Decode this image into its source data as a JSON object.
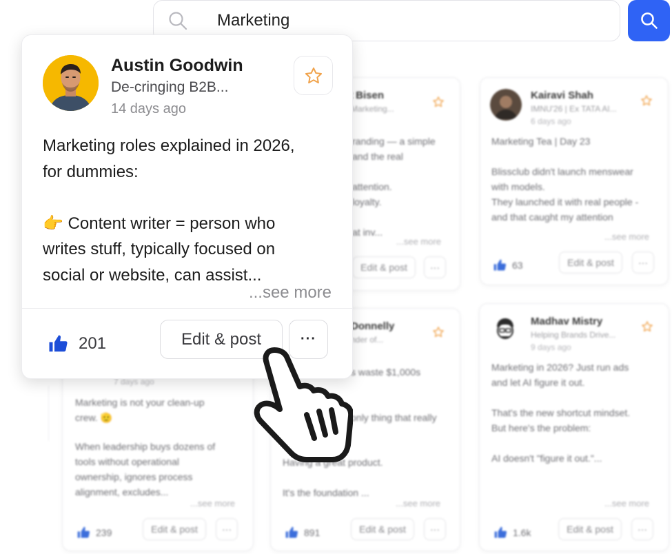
{
  "search": {
    "query": "Marketing",
    "icon": "search-icon",
    "button_icon": "search-icon",
    "button_color": "#2f63f5"
  },
  "featured_post": {
    "author": "Austin Goodwin",
    "headline": "De-cringing B2B...",
    "age": "14 days ago",
    "text_lines": [
      "Marketing roles explained in 2026,",
      "for dummies:",
      "",
      "👉 Content writer = person who",
      "writes stuff, typically focused on",
      "social or website, can assist..."
    ],
    "see_more": "...see more",
    "likes": "201",
    "edit_label": "Edit & post",
    "more_label": "···",
    "star_icon": "star-icon",
    "like_icon": "thumbs-up-icon"
  },
  "background_posts": [
    {
      "name": "t Bisen",
      "sub": "Marketing...",
      "body": [
        "randing — a simple",
        "and the real",
        "",
        "attention.",
        "loyalty.",
        "",
        "at inv..."
      ],
      "see_more": "...see more",
      "likes": "",
      "edit_label": "Edit & post",
      "more_label": "···"
    },
    {
      "name": "Kairavi Shah",
      "sub": "IMNU'26 | Ex TATA AI...",
      "age": "6 days ago",
      "body": [
        "Marketing Tea | Day 23",
        "",
        "Blissclub didn't launch menswear",
        "with models.",
        "They launched it with real people -",
        "and that caught my attention"
      ],
      "see_more": "...see more",
      "likes": "63",
      "edit_label": "Edit & post",
      "more_label": "···"
    },
    {
      "name": "",
      "sub": "",
      "age": "7 days ago",
      "body": [
        "Marketing is not your clean-up",
        "crew. 🫡",
        "",
        "When leadership buys dozens of",
        "tools without operational",
        "ownership, ignores process",
        "alignment, excludes..."
      ],
      "see_more": "...see more",
      "likes": "239",
      "edit_label": "Edit & post",
      "more_label": "···"
    },
    {
      "name": "Donnelly",
      "sub": "nder of...",
      "body": [
        "s waste $1,000s",
        "",
        "",
        "only thing that really",
        "",
        "Having a great product.",
        "",
        "It's the foundation ..."
      ],
      "see_more": "...see more",
      "likes": "891",
      "edit_label": "Edit & post",
      "more_label": "···"
    },
    {
      "name": "Madhav Mistry",
      "sub": "Helping Brands Drive...",
      "age": "9 days ago",
      "body": [
        "Marketing in 2026? Just run ads",
        "and let AI figure it out.",
        "",
        "That's the new shortcut mindset.",
        "But here's the problem:",
        "",
        "AI doesn't \"figure it out.\"..."
      ],
      "see_more": "...see more",
      "likes": "1.6k",
      "edit_label": "Edit & post",
      "more_label": "···"
    }
  ],
  "colors": {
    "accent": "#2f63f5",
    "star": "#f0a24a",
    "like": "#1d4ed8"
  }
}
